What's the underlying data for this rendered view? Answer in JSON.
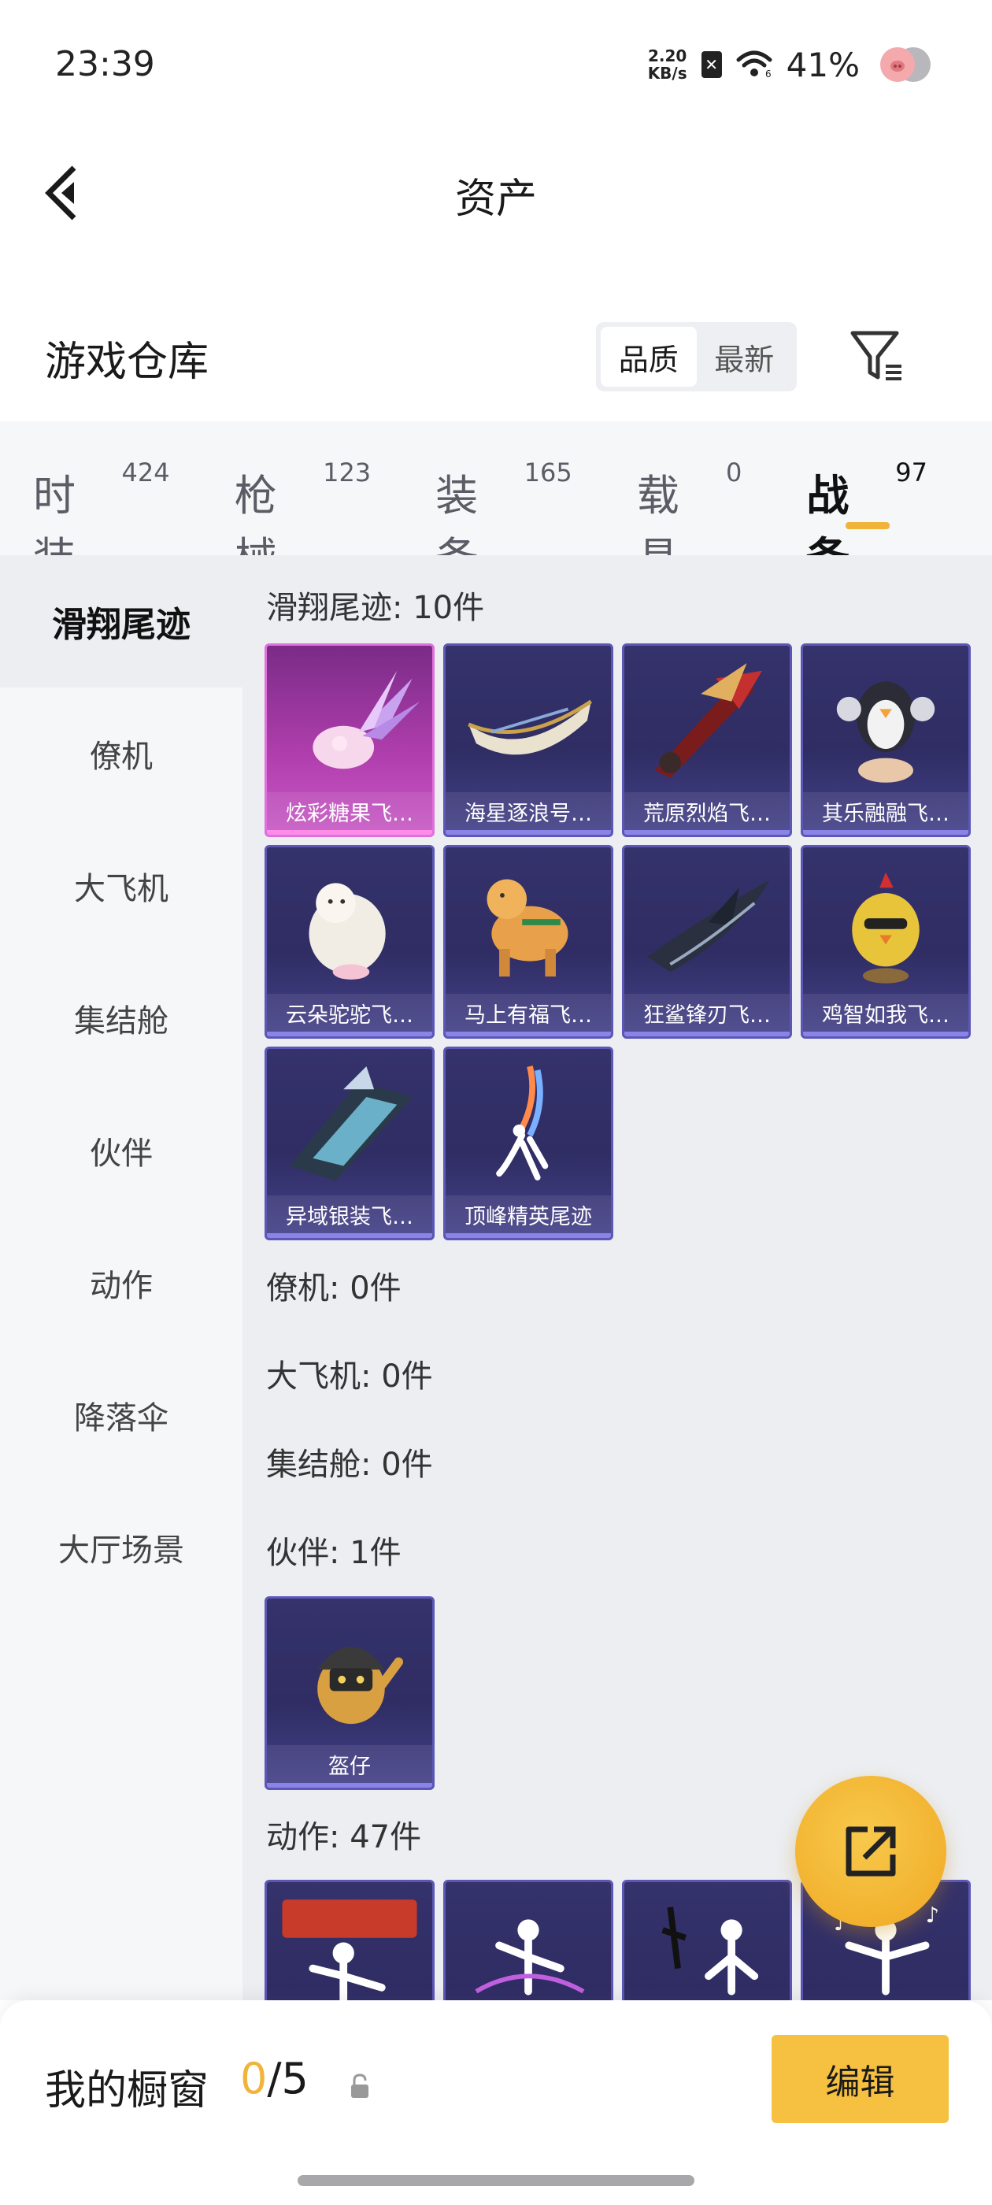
{
  "status_bar": {
    "time": "23:39",
    "net_speed_value": "2.20",
    "net_speed_unit": "KB/s",
    "battery": "41%"
  },
  "header": {
    "title": "资产"
  },
  "warehouse": {
    "title": "游戏仓库",
    "sort_options": [
      "品质",
      "最新"
    ],
    "sort_selected": "品质"
  },
  "tabs": [
    {
      "label": "时装",
      "count": "424"
    },
    {
      "label": "枪械",
      "count": "123"
    },
    {
      "label": "装备",
      "count": "165"
    },
    {
      "label": "载具",
      "count": "0"
    },
    {
      "label": "战备",
      "count": "97",
      "active": true
    }
  ],
  "sidebar": {
    "items": [
      {
        "label": "滑翔尾迹",
        "active": true
      },
      {
        "label": "僚机"
      },
      {
        "label": "大飞机"
      },
      {
        "label": "集结舱"
      },
      {
        "label": "伙伴"
      },
      {
        "label": "动作"
      },
      {
        "label": "降落伞"
      },
      {
        "label": "大厅场景"
      }
    ]
  },
  "sections": {
    "glide": {
      "title": "滑翔尾迹: 10件",
      "items": [
        {
          "name": "炫彩糖果飞…",
          "rarity": "pink"
        },
        {
          "name": "海星逐浪号…",
          "rarity": "purple"
        },
        {
          "name": "荒原烈焰飞…",
          "rarity": "purple"
        },
        {
          "name": "其乐融融飞…",
          "rarity": "purple"
        },
        {
          "name": "云朵驼驼飞…",
          "rarity": "purple"
        },
        {
          "name": "马上有福飞…",
          "rarity": "purple"
        },
        {
          "name": "狂鲨锋刃飞…",
          "rarity": "purple"
        },
        {
          "name": "鸡智如我飞…",
          "rarity": "purple"
        },
        {
          "name": "异域银装飞…",
          "rarity": "purple"
        },
        {
          "name": "顶峰精英尾迹",
          "rarity": "purple"
        }
      ]
    },
    "wingman": {
      "title": "僚机: 0件"
    },
    "plane": {
      "title": "大飞机: 0件"
    },
    "pod": {
      "title": "集结舱: 0件"
    },
    "companion": {
      "title": "伙伴: 1件",
      "items": [
        {
          "name": "盔仔",
          "rarity": "purple"
        }
      ]
    },
    "emote": {
      "title": "动作: 47件"
    }
  },
  "bottom": {
    "showcase_label": "我的橱窗",
    "showcase_used": "0",
    "showcase_total": "/5",
    "edit_label": "编辑"
  },
  "colors": {
    "accent": "#f0b43a",
    "card_purple": "#35326c",
    "card_pink": "#b23fae"
  }
}
